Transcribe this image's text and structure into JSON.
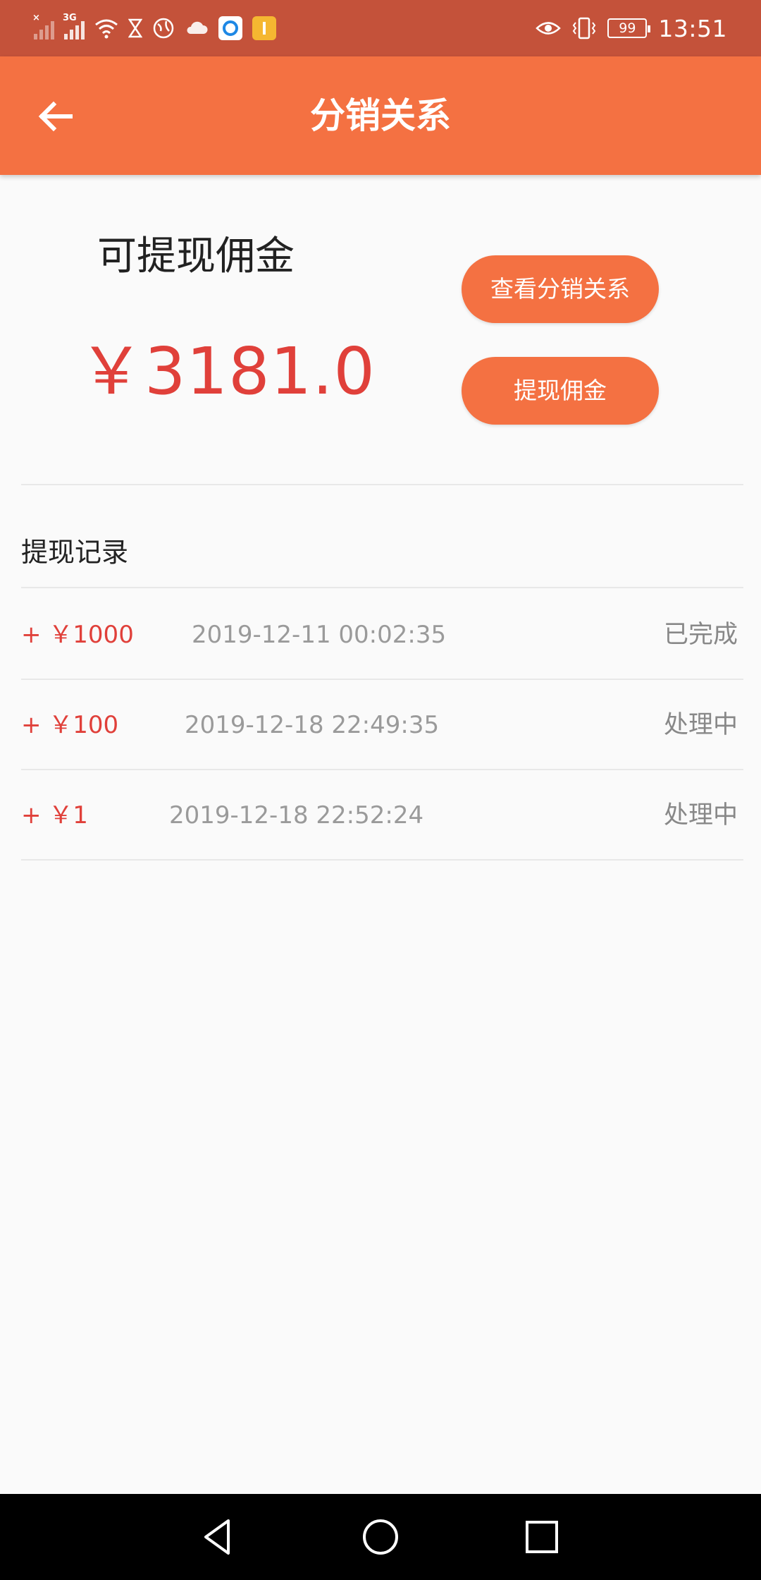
{
  "status_bar": {
    "time": "13:51",
    "battery": "99",
    "network_label": "3G",
    "icons": [
      "signal-no-sim-icon",
      "signal-3g-icon",
      "wifi-icon",
      "hourglass-icon",
      "globe-icon",
      "cloud-icon",
      "app-notification-icon",
      "app-notification-icon",
      "eye-comfort-icon",
      "vibrate-icon",
      "battery-icon"
    ]
  },
  "app_bar": {
    "title": "分销关系",
    "back_icon": "arrow-left-icon",
    "color": "#f47142"
  },
  "commission": {
    "label": "可提现佣金",
    "amount": "￥3181.0",
    "amount_color": "#e0403a"
  },
  "actions": {
    "view_relations_label": "查看分销关系",
    "withdraw_label": "提现佣金"
  },
  "records": {
    "title": "提现记录",
    "items": [
      {
        "amount": "+ ￥1000",
        "time": "2019-12-11 00:02:35",
        "status": "已完成"
      },
      {
        "amount": "+ ￥100",
        "time": "2019-12-18 22:49:35",
        "status": "处理中"
      },
      {
        "amount": "+ ￥1",
        "time": "2019-12-18 22:52:24",
        "status": "处理中"
      }
    ]
  },
  "nav_bar": {
    "icons": [
      "nav-back-icon",
      "nav-home-icon",
      "nav-recents-icon"
    ]
  }
}
